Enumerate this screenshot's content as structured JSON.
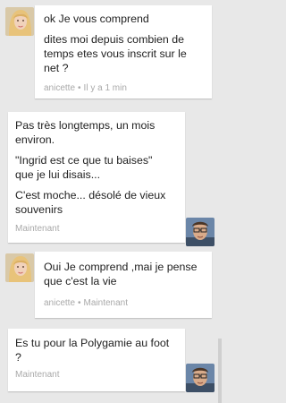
{
  "colors": {
    "background": "#e8e8e8",
    "bubble": "#ffffff",
    "text": "#222222",
    "meta": "#a9a9a9"
  },
  "messages": [
    {
      "sender": "anicette",
      "avatar": "blonde-woman-avatar",
      "lines": [
        "ok Je vous comprend",
        "dites moi depuis combien de\ntemps etes vous inscrit sur le\nnet ?"
      ],
      "author": "anicette",
      "time": "Il y a 1 min"
    },
    {
      "sender": "me",
      "avatar": "man-with-glasses-avatar",
      "lines": [
        "Pas très longtemps, un mois\nenviron.",
        "\"Ingrid est ce que tu baises\"\nque je lui disais...",
        "C'est moche... désolé de vieux\nsouvenirs"
      ],
      "time": "Maintenant"
    },
    {
      "sender": "anicette",
      "avatar": "blonde-woman-avatar",
      "lines": [
        "Oui Je comprend ,mai je pense\nque c'est la vie"
      ],
      "author": "anicette",
      "time": "Maintenant"
    },
    {
      "sender": "me",
      "avatar": "man-with-glasses-avatar",
      "lines": [
        "Es tu pour la Polygamie au foot\n?"
      ],
      "time": "Maintenant"
    }
  ]
}
